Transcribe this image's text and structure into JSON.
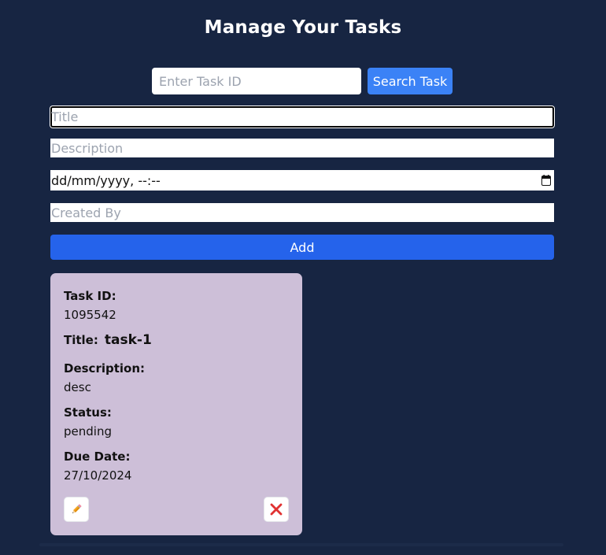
{
  "header": {
    "title": "Manage Your Tasks"
  },
  "search": {
    "placeholder": "Enter Task ID",
    "value": "",
    "button_label": "Search Task"
  },
  "form": {
    "title_placeholder": "Title",
    "description_placeholder": "Description",
    "due_date_display": "dd/mm/yyyy, --:--",
    "created_by_placeholder": "Created By",
    "add_label": "Add"
  },
  "colors": {
    "background": "#172542",
    "search_button": "#3b82f6",
    "add_button": "#2563eb",
    "card": "#cdbfd8",
    "delete_icon": "#e03131"
  },
  "icons": {
    "edit": "pencil-icon",
    "delete": "x-icon",
    "calendar": "calendar-icon"
  },
  "tasks": [
    {
      "id_label": "Task ID:",
      "id": "1095542",
      "title_label": "Title:",
      "title": "task-1",
      "description_label": "Description:",
      "description": "desc",
      "status_label": "Status:",
      "status": "pending",
      "due_date_label": "Due Date:",
      "due_date": "27/10/2024"
    }
  ]
}
